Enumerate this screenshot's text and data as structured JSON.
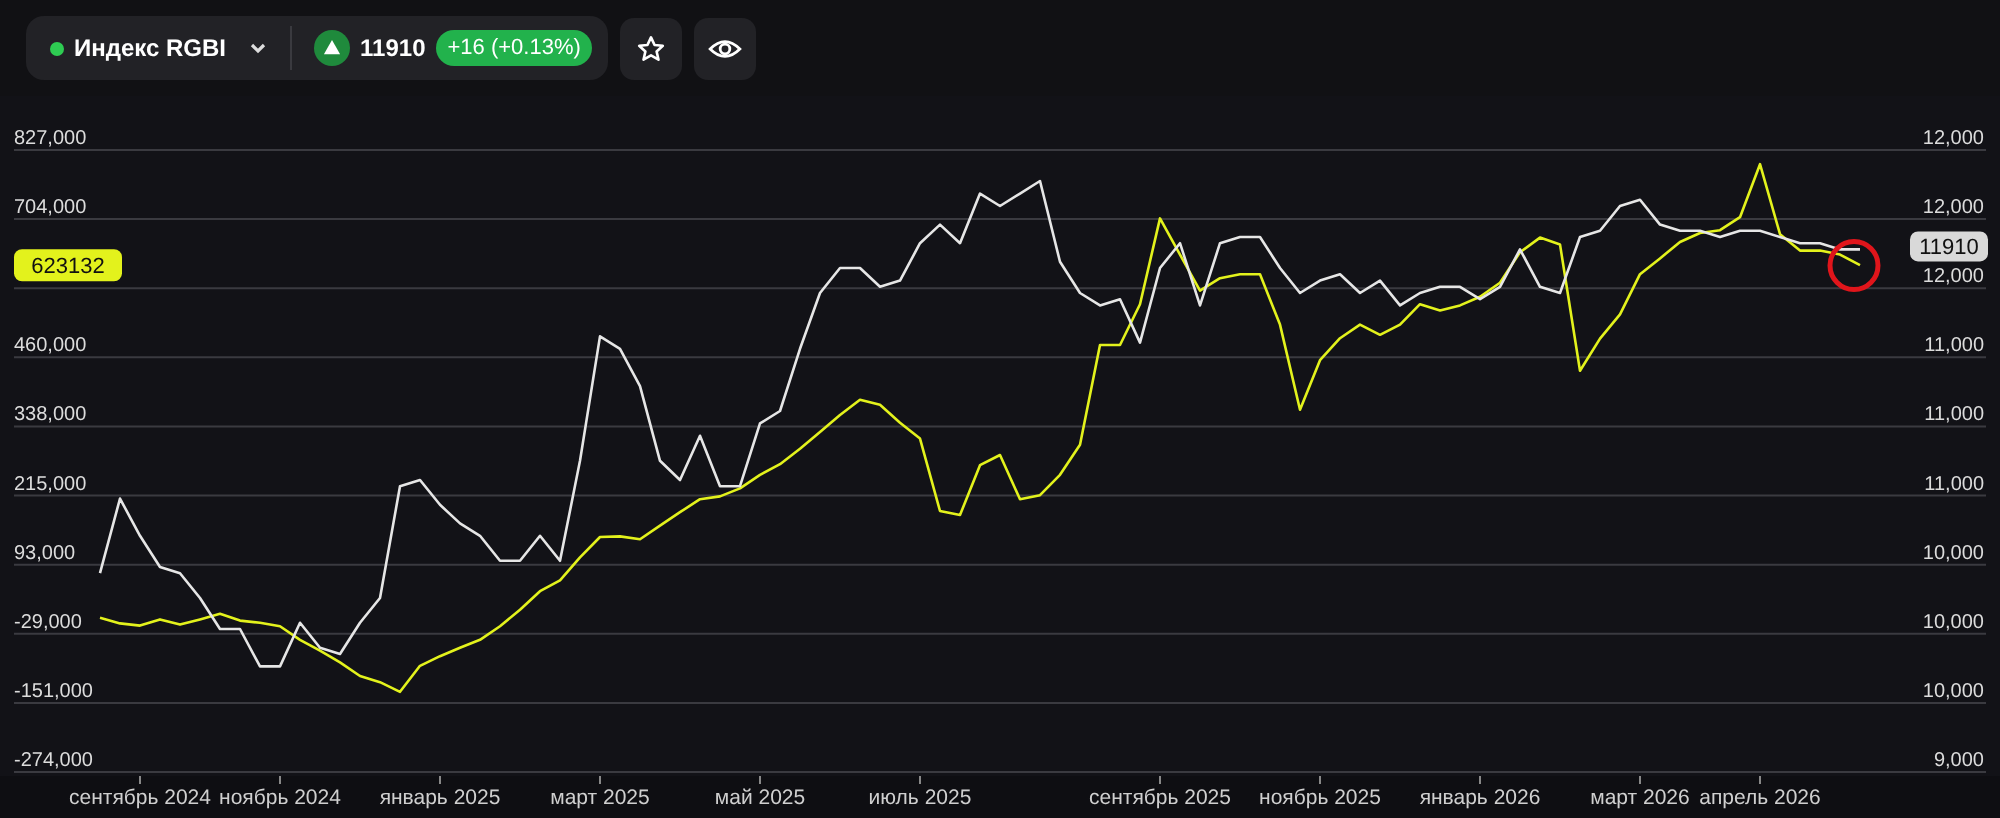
{
  "header": {
    "instrument": {
      "name": "Индекс RGBI",
      "live": true
    },
    "price": "11910",
    "up": true,
    "change": "+16 (+0.13%)",
    "favorite": false
  },
  "chart": {
    "chart_data": {
      "type": "line",
      "categories": [
        null,
        null,
        "сентябрь 2024",
        null,
        null,
        null,
        null,
        null,
        null,
        "ноябрь 2024",
        null,
        null,
        null,
        null,
        null,
        null,
        null,
        "январь 2025",
        null,
        null,
        null,
        null,
        null,
        null,
        null,
        "март 2025",
        null,
        null,
        null,
        null,
        null,
        null,
        null,
        "май 2025",
        null,
        null,
        null,
        null,
        null,
        null,
        null,
        "июль 2025",
        null,
        null,
        null,
        null,
        null,
        null,
        null,
        null,
        null,
        null,
        null,
        "сентябрь 2025",
        null,
        null,
        null,
        null,
        null,
        null,
        null,
        "ноябрь 2025",
        null,
        null,
        null,
        null,
        null,
        null,
        null,
        "январь 2026",
        null,
        null,
        null,
        null,
        null,
        null,
        null,
        "март 2026",
        null,
        null,
        null,
        null,
        null,
        "апрель 2026",
        null,
        null,
        null,
        null,
        null
      ],
      "grid": true,
      "ylim": [
        -274000,
        827000
      ],
      "yticks": [
        {
          "value": 827000,
          "label": "827,000"
        },
        {
          "value": 704000,
          "label": "704,000"
        },
        {
          "value": 460000,
          "label": "460,000"
        },
        {
          "value": 338000,
          "label": "338,000"
        },
        {
          "value": 215000,
          "label": "215,000"
        },
        {
          "value": 93000,
          "label": "93,000"
        },
        {
          "value": -29000,
          "label": "-29,000"
        },
        {
          "value": -151000,
          "label": "-151,000"
        },
        {
          "value": -274000,
          "label": "-274,000"
        }
      ],
      "series": [
        {
          "color": "#e3f21c",
          "values": [
            -1000,
            -11000,
            -15000,
            -4000,
            -13000,
            -4000,
            6000,
            -6000,
            -10000,
            -16000,
            -40000,
            -59000,
            -80000,
            -104000,
            -115000,
            -132000,
            -86000,
            -69000,
            -54000,
            -40000,
            -16000,
            13000,
            46000,
            65000,
            106000,
            142000,
            143000,
            138000,
            162000,
            186000,
            209000,
            214000,
            228000,
            252000,
            271000,
            298000,
            328000,
            358000,
            385000,
            376000,
            344000,
            316000,
            188000,
            181000,
            269000,
            287000,
            209000,
            216000,
            252000,
            305000,
            482000,
            482000,
            554000,
            706000,
            642000,
            578000,
            600000,
            607000,
            607000,
            518000,
            367000,
            455000,
            494000,
            518000,
            500000,
            518000,
            554000,
            543000,
            552000,
            567000,
            592000,
            646000,
            672000,
            660000,
            436000,
            493000,
            536000,
            607000,
            635000,
            664000,
            680000,
            685000,
            708000,
            802000,
            678000,
            649000,
            649000,
            642000,
            623000
          ]
        },
        {
          "color": "#e6e6e6",
          "values": [
            78000,
            210000,
            144000,
            89000,
            78000,
            34000,
            -21000,
            -21000,
            -87000,
            -87000,
            -10000,
            -54000,
            -65000,
            -10000,
            34000,
            232000,
            243000,
            199000,
            166000,
            144000,
            100000,
            100000,
            144000,
            100000,
            277000,
            497000,
            475000,
            409000,
            277000,
            243000,
            321000,
            232000,
            232000,
            343000,
            365000,
            475000,
            574000,
            618000,
            618000,
            585000,
            596000,
            662000,
            695000,
            662000,
            750000,
            728000,
            750000,
            772000,
            629000,
            574000,
            552000,
            563000,
            486000,
            618000,
            662000,
            552000,
            662000,
            673000,
            673000,
            618000,
            574000,
            596000,
            607000,
            574000,
            596000,
            552000,
            574000,
            585000,
            585000,
            563000,
            585000,
            651000,
            585000,
            574000,
            673000,
            684000,
            728000,
            739000,
            695000,
            684000,
            684000,
            673000,
            684000,
            684000,
            673000,
            662000,
            662000,
            651000,
            651000
          ]
        }
      ]
    },
    "right_axis": [
      "12,000",
      "12,000",
      "12,000",
      "11,000",
      "11,000",
      "11,000",
      "10,000",
      "10,000",
      "10,000",
      "9,000"
    ],
    "last_values": [
      {
        "kind": "tag",
        "text": "623132"
      },
      {
        "kind": "chip",
        "text": "11910"
      }
    ],
    "highlight": true
  }
}
